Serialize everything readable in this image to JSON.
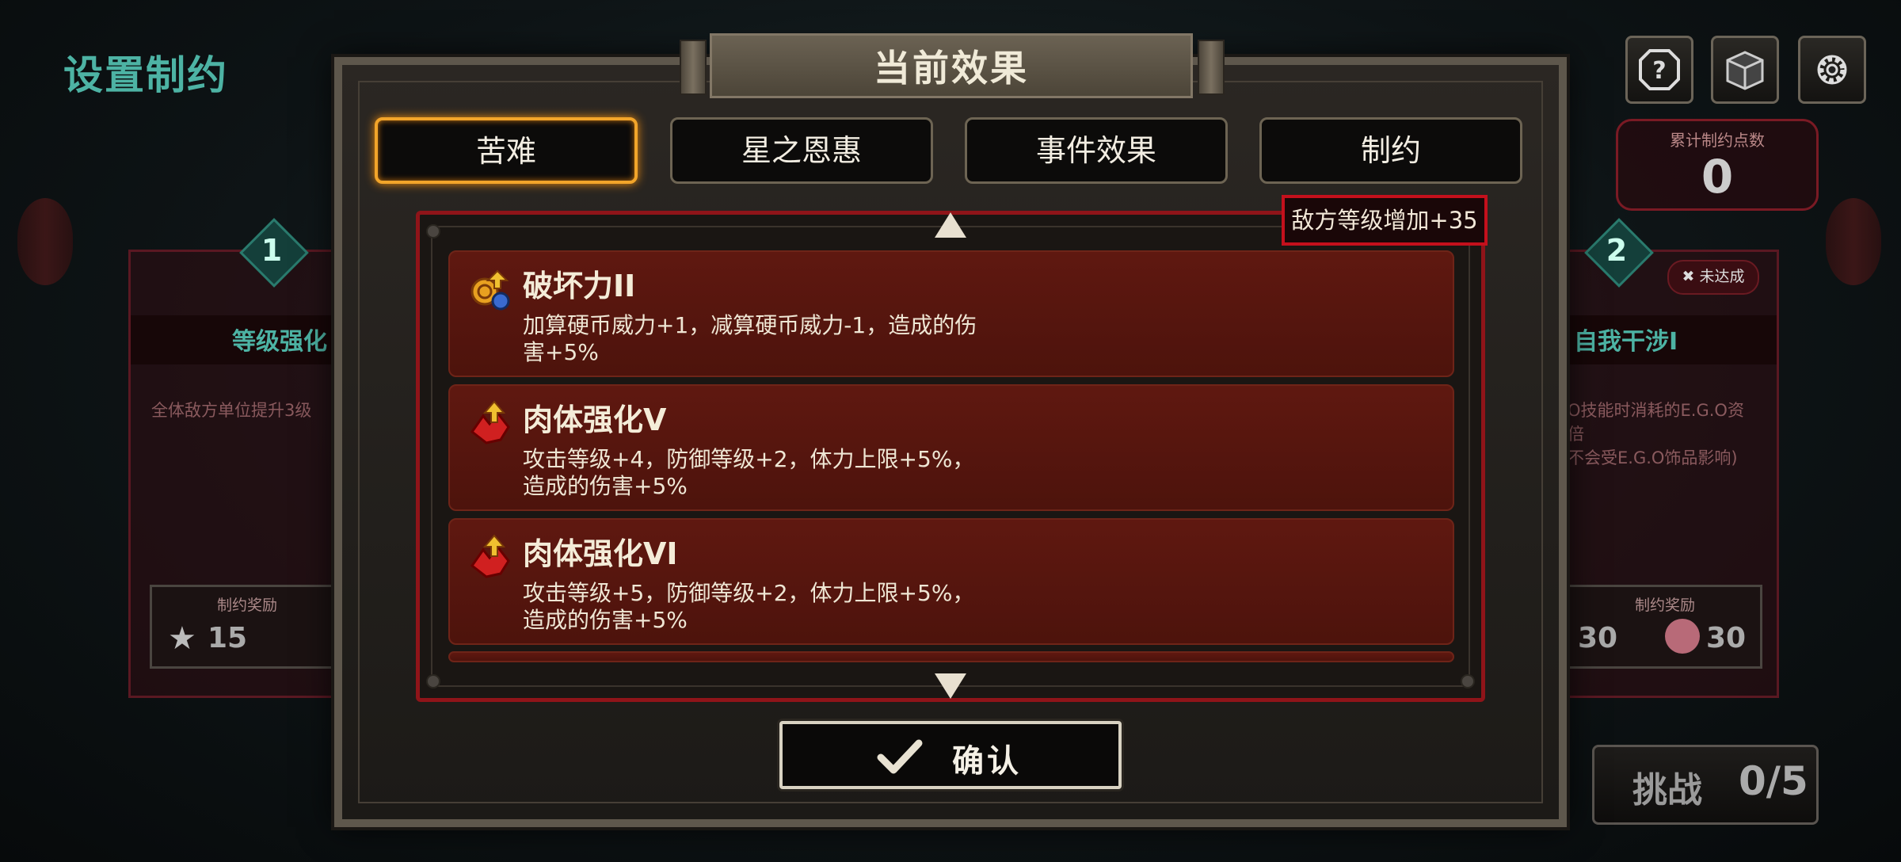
{
  "screen": {
    "title": "设置制约",
    "points": {
      "label": "累计制约点数",
      "value": "0"
    },
    "left_card": {
      "number": "1",
      "title": "等级强化",
      "description": "全体敌方单位提升3级",
      "reward_label": "制约奖励",
      "reward_value_1": "15"
    },
    "right_card": {
      "number": "2",
      "status_badge": "未达成",
      "title": "自我干涉I",
      "description_line1": "O技能时消耗的E.G.O资",
      "description_line2": "倍",
      "description_line3": "不会受E.G.O饰品影响)",
      "reward_label": "制约奖励",
      "reward_value_1": "30",
      "reward_value_2": "30"
    },
    "challenge": {
      "label": "挑战",
      "count": "0/5"
    }
  },
  "modal": {
    "title": "当前效果",
    "tabs": [
      {
        "label": "苦难",
        "active": true
      },
      {
        "label": "星之恩惠",
        "active": false
      },
      {
        "label": "事件效果",
        "active": false
      },
      {
        "label": "制约",
        "active": false
      }
    ],
    "enemy_level_badge": "敌方等级增加+35",
    "effects": [
      {
        "name": "破坏力II",
        "desc_line1": "加算硬币威力+1，减算硬币威力-1，造成的伤",
        "desc_line2": "害+5%",
        "icon": "coin-power-icon"
      },
      {
        "name": "肉体强化V",
        "desc_line1": "攻击等级+4，防御等级+2，体力上限+5%，",
        "desc_line2": "造成的伤害+5%",
        "icon": "body-boost-icon"
      },
      {
        "name": "肉体强化VI",
        "desc_line1": "攻击等级+5，防御等级+2，体力上限+5%，",
        "desc_line2": "造成的伤害+5%",
        "icon": "body-boost-icon"
      }
    ],
    "confirm_label": "确认"
  },
  "colors": {
    "accent_teal": "#4db3a4",
    "active_tab_orange": "#f2a52a",
    "frame_red": "#8f1419",
    "card_red": "#5f1810"
  }
}
